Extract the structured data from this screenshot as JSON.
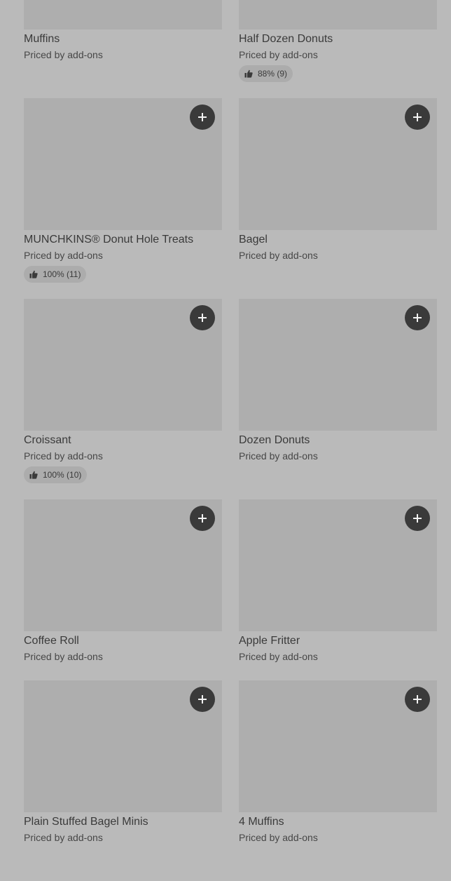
{
  "price_label": "Priced by add-ons",
  "items": [
    {
      "title": "Muffins",
      "price": "Priced by add-ons",
      "rating": null
    },
    {
      "title": "Half Dozen Donuts",
      "price": "Priced by add-ons",
      "rating": "88% (9)"
    },
    {
      "title": "MUNCHKINS® Donut Hole Treats",
      "price": "Priced by add-ons",
      "rating": "100% (11)"
    },
    {
      "title": "Bagel",
      "price": "Priced by add-ons",
      "rating": null
    },
    {
      "title": "Croissant",
      "price": "Priced by add-ons",
      "rating": "100% (10)"
    },
    {
      "title": "Dozen Donuts",
      "price": "Priced by add-ons",
      "rating": null
    },
    {
      "title": "Coffee Roll",
      "price": "Priced by add-ons",
      "rating": null
    },
    {
      "title": "Apple Fritter",
      "price": "Priced by add-ons",
      "rating": null
    },
    {
      "title": "Plain Stuffed Bagel Minis",
      "price": "Priced by add-ons",
      "rating": null
    },
    {
      "title": "4 Muffins",
      "price": "Priced by add-ons",
      "rating": null
    }
  ],
  "icons": {
    "add": "plus-icon",
    "rating": "thumbs-up-icon"
  },
  "colors": {
    "background": "#bababa",
    "thumbnail": "#aeaeae",
    "add_button": "#3a3a3a",
    "rating_pill": "#acacac",
    "text": "#3a3a3a"
  }
}
